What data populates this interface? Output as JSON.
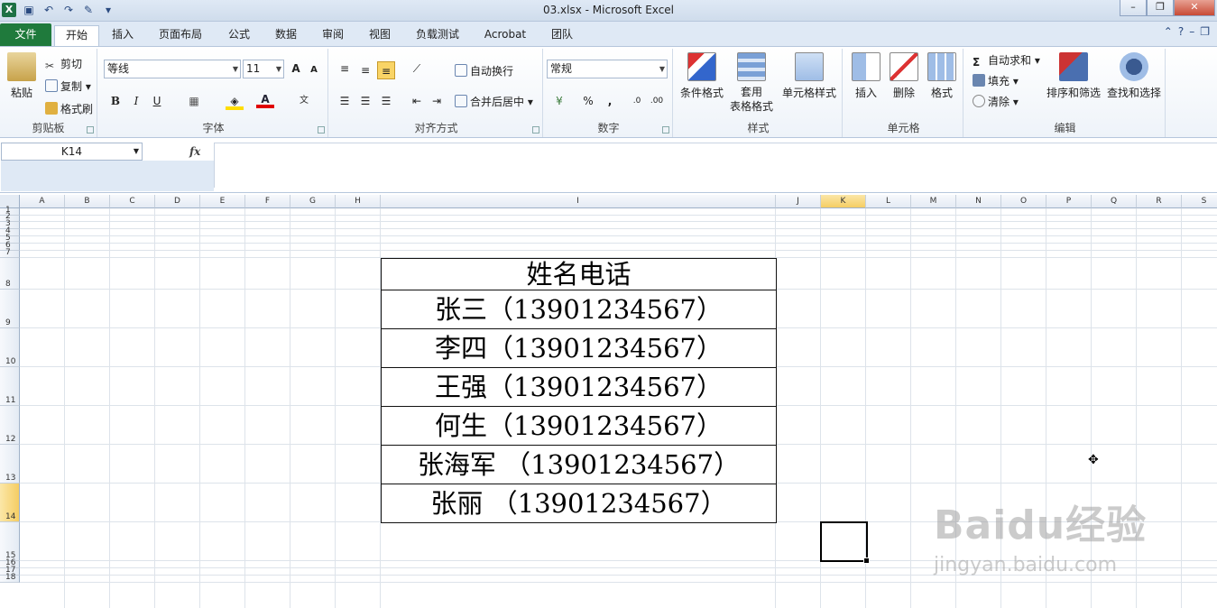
{
  "window": {
    "title": "03.xlsx - Microsoft Excel",
    "controls": {
      "minimize": "–",
      "restore": "❐",
      "close": "✕"
    }
  },
  "tabs": [
    {
      "label": "文件"
    },
    {
      "label": "开始"
    },
    {
      "label": "插入"
    },
    {
      "label": "页面布局"
    },
    {
      "label": "公式"
    },
    {
      "label": "数据"
    },
    {
      "label": "审阅"
    },
    {
      "label": "视图"
    },
    {
      "label": "负载测试"
    },
    {
      "label": "Acrobat"
    },
    {
      "label": "团队"
    }
  ],
  "ribbon": {
    "clipboard": {
      "label": "剪贴板",
      "paste": "粘贴",
      "cut": "剪切",
      "copy": "复制",
      "format_painter": "格式刷"
    },
    "font": {
      "label": "字体",
      "font_name": "等线",
      "font_size": "11",
      "bold": "B",
      "italic": "I",
      "underline": "U",
      "grow": "A",
      "shrink": "A"
    },
    "alignment": {
      "label": "对齐方式",
      "wrap_text": "自动换行",
      "merge_center": "合并后居中"
    },
    "number": {
      "label": "数字",
      "format": "常规",
      "percent": "%",
      "comma": ","
    },
    "styles": {
      "label": "样式",
      "conditional": "条件格式",
      "table_format_1": "套用",
      "table_format_2": "表格格式",
      "cell_styles": "单元格样式"
    },
    "cells": {
      "label": "单元格",
      "insert": "插入",
      "delete": "删除",
      "format": "格式"
    },
    "editing": {
      "label": "编辑",
      "autosum": "自动求和",
      "fill": "填充",
      "clear": "清除",
      "sort_filter": "排序和筛选",
      "find_select": "查找和选择"
    }
  },
  "formula_bar": {
    "name_box": "K14",
    "fx": "fx",
    "formula": ""
  },
  "sheet": {
    "columns": [
      "A",
      "B",
      "C",
      "D",
      "E",
      "F",
      "G",
      "H",
      "I",
      "J",
      "K",
      "L",
      "M",
      "N",
      "O",
      "P",
      "Q",
      "R",
      "S"
    ],
    "rows": [
      "1",
      "2",
      "3",
      "4",
      "5",
      "6",
      "7",
      "8",
      "9",
      "10",
      "11",
      "12",
      "13",
      "14",
      "15",
      "16",
      "17",
      "18"
    ],
    "selected_column": "K",
    "selected_row": "14",
    "table": [
      "姓名电话",
      "张三（13901234567）",
      "李四（13901234567）",
      "王强（13901234567）",
      "何生（13901234567）",
      "张海军 （13901234567）",
      "张丽 （13901234567）"
    ]
  },
  "watermark": {
    "brand": "Baidu经验",
    "url": "jingyan.baidu.com"
  },
  "colors": {
    "file_tab": "#1f7a3c",
    "selection_header": "#f5cd63"
  }
}
